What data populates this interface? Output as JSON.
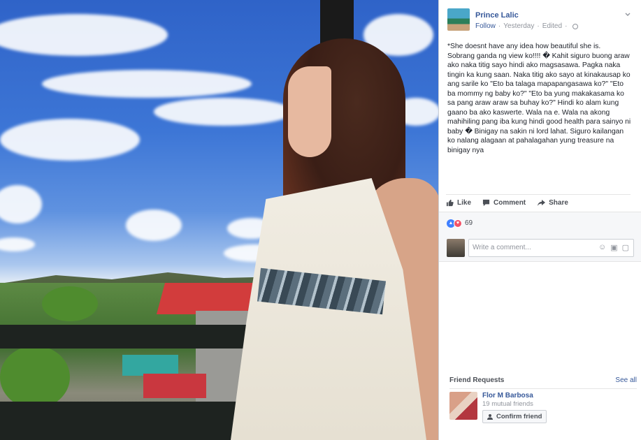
{
  "post": {
    "author": "Prince Lalic",
    "follow_label": "Follow",
    "time": "Yesterday",
    "edited": "Edited",
    "caption": "*She doesnt have any idea how beautiful she is.\nSobrang ganda ng view ko!!!! � Kahit siguro buong araw ako naka titig sayo hindi ako magsasawa. Pagka naka tingin ka kung saan. Naka titig ako sayo at kinakausap ko ang sarile ko \"Eto ba talaga mapapangasawa ko?\" \"Eto ba mommy ng baby ko?\" \"Eto ba yung makakasama ko sa pang araw araw sa buhay ko?\" Hindi ko alam kung gaano ba ako kaswerte. Wala na e. Wala na akong mahihiling pang iba kung hindi good health para sainyo ni baby � Binigay na sakin ni lord lahat. Siguro kailangan ko nalang alagaan at pahalagahan yung treasure na binigay nya"
  },
  "actions": {
    "like": "Like",
    "comment": "Comment",
    "share": "Share"
  },
  "reactions": {
    "count": "69"
  },
  "comment_box": {
    "placeholder": "Write a comment..."
  },
  "friend_requests": {
    "title": "Friend Requests",
    "see_all": "See all",
    "items": [
      {
        "name": "Flor M Barbosa",
        "mutual": "19 mutual friends",
        "confirm_label": "Confirm friend"
      }
    ]
  }
}
